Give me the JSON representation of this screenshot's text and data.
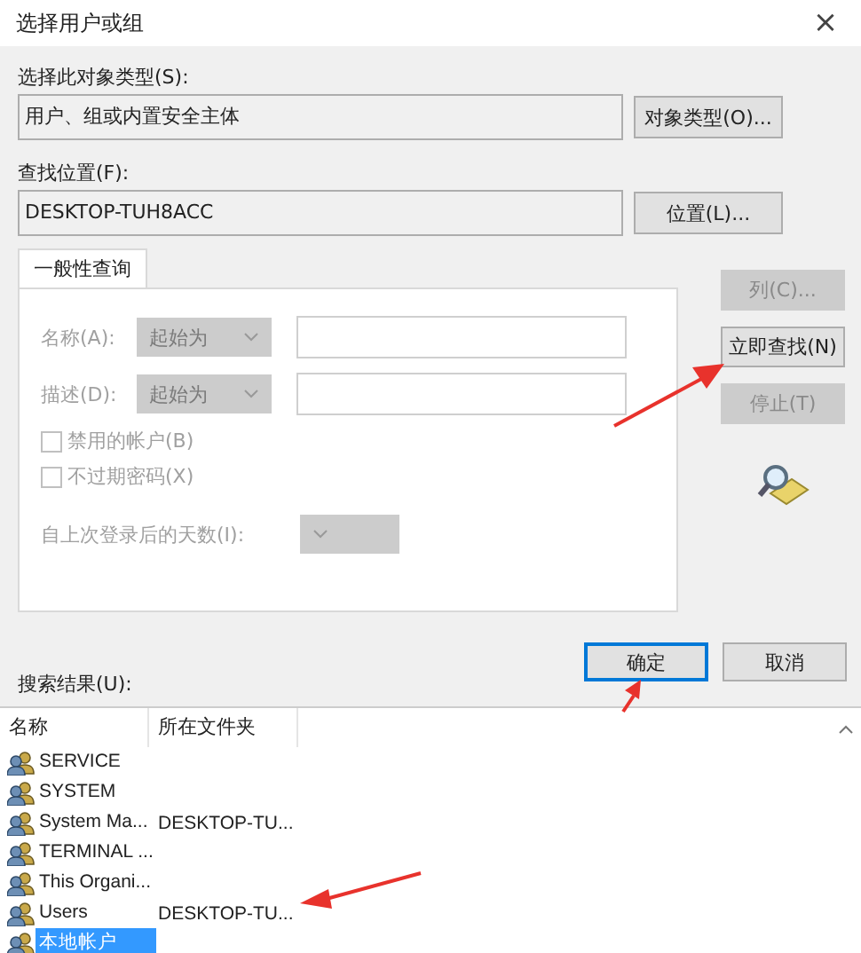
{
  "window": {
    "title": "选择用户或组",
    "close": "×"
  },
  "object_type": {
    "label": "选择此对象类型(S):",
    "value": "用户、组或内置安全主体",
    "button": "对象类型(O)..."
  },
  "location": {
    "label": "查找位置(F):",
    "value": "DESKTOP-TUH8ACC",
    "button": "位置(L)..."
  },
  "tabs": [
    {
      "label": "一般性查询",
      "selected": true
    }
  ],
  "query_fields": [
    {
      "label": "名称(A):",
      "dropdown": "起始为",
      "disabled": true
    },
    {
      "label": "描述(D):",
      "dropdown": "起始为",
      "disabled": true
    }
  ],
  "checkboxes": [
    {
      "label": "禁用的帐户(B)",
      "checked": false,
      "disabled": true
    },
    {
      "label": "不过期密码(X)",
      "checked": false,
      "disabled": true
    }
  ],
  "days_since_login": {
    "label": "自上次登录后的天数(I):",
    "disabled": true
  },
  "side_buttons": [
    {
      "label": "列(C)...",
      "disabled": true
    },
    {
      "label": "立即查找(N)",
      "disabled": false
    },
    {
      "label": "停止(T)",
      "disabled": true
    }
  ],
  "ok_button": {
    "label": "确定",
    "default": true
  },
  "cancel_button": {
    "label": "取消"
  },
  "results_label": "搜索结果(U):",
  "columns": [
    "名称",
    "所在文件夹"
  ],
  "rows": [
    {
      "name": "SERVICE",
      "folder": "",
      "selected": false
    },
    {
      "name": "SYSTEM",
      "folder": "",
      "selected": false
    },
    {
      "name": "System Ma...",
      "folder": "DESKTOP-TU...",
      "selected": false
    },
    {
      "name": "TERMINAL ...",
      "folder": "",
      "selected": false
    },
    {
      "name": "This Organi...",
      "folder": "",
      "selected": false
    },
    {
      "name": "Users",
      "folder": "DESKTOP-TU...",
      "selected": false
    },
    {
      "name": "本地帐户",
      "folder": "",
      "selected": true
    }
  ]
}
